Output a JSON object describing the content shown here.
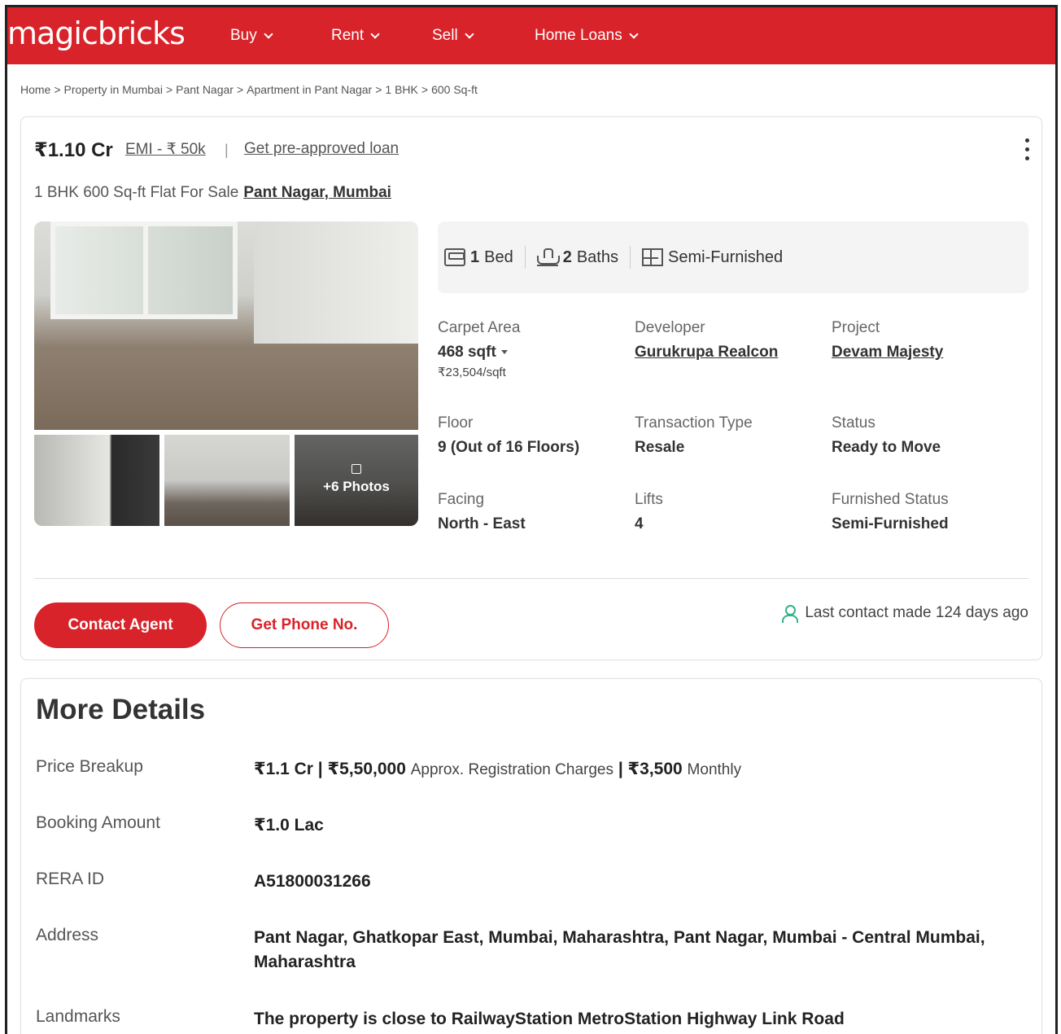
{
  "header": {
    "logo": "magicbricks",
    "nav": [
      "Buy",
      "Rent",
      "Sell",
      "Home Loans"
    ],
    "brand_color": "#d8232a"
  },
  "breadcrumb": [
    "Home",
    "Property in Mumbai",
    "Pant Nagar",
    "Apartment in Pant Nagar",
    "1 BHK",
    "600 Sq-ft"
  ],
  "listing": {
    "price": "₹1.10 Cr",
    "emi": "EMI - ₹ 50k",
    "separator": "|",
    "preapproved_link": "Get pre-approved loan",
    "title": "1 BHK 600 Sq-ft Flat For Sale",
    "location": "Pant Nagar, Mumbai",
    "more_photos": "+6 Photos",
    "amenities": {
      "beds_count": "1",
      "beds_label": "Bed",
      "baths_count": "2",
      "baths_label": "Baths",
      "furnishing": "Semi-Furnished"
    },
    "specs": {
      "carpet_label": "Carpet Area",
      "carpet_value": "468 sqft",
      "carpet_rate": "₹23,504/sqft",
      "developer_label": "Developer",
      "developer_value": "Gurukrupa Realcon",
      "project_label": "Project",
      "project_value": "Devam Majesty",
      "floor_label": "Floor",
      "floor_value": "9 (Out of 16 Floors)",
      "transaction_label": "Transaction Type",
      "transaction_value": "Resale",
      "status_label": "Status",
      "status_value": "Ready to Move",
      "facing_label": "Facing",
      "facing_value": "North - East",
      "lifts_label": "Lifts",
      "lifts_value": "4",
      "furnished_label": "Furnished Status",
      "furnished_value": "Semi-Furnished"
    },
    "contact_button": "Contact Agent",
    "phone_button": "Get Phone No.",
    "last_contact": "Last contact made 124 days ago"
  },
  "more_details": {
    "title": "More Details",
    "price_breakup_label": "Price Breakup",
    "price_breakup_price": "₹1.1 Cr | ₹5,50,000",
    "price_breakup_reg": "Approx. Registration Charges",
    "price_breakup_monthly_amount": "| ₹3,500",
    "price_breakup_monthly": "Monthly",
    "booking_label": "Booking Amount",
    "booking_value": "₹1.0 Lac",
    "rera_label": "RERA ID",
    "rera_value": "A51800031266",
    "address_label": "Address",
    "address_value": "Pant Nagar, Ghatkopar East, Mumbai, Maharashtra, Pant Nagar, Mumbai - Central Mumbai, Maharashtra",
    "landmarks_label": "Landmarks",
    "landmarks_value": "The property is close to RailwayStation MetroStation Highway Link Road"
  }
}
